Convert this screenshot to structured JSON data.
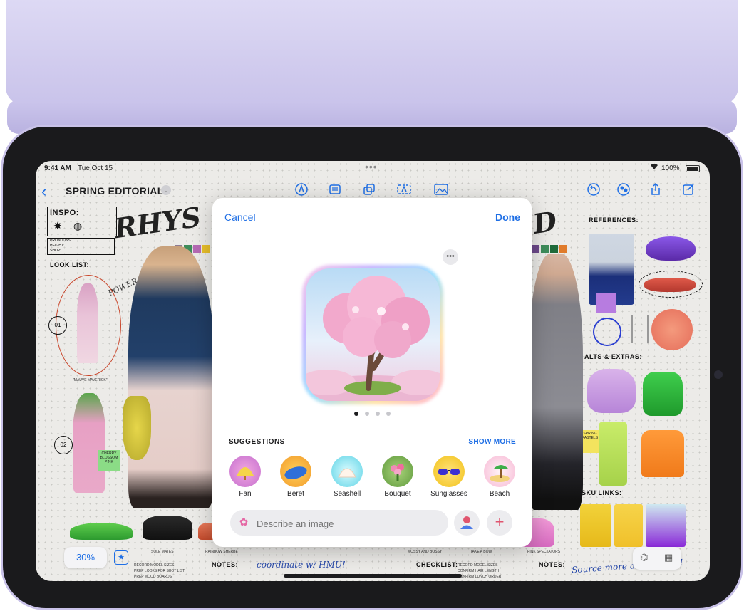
{
  "status_bar": {
    "time": "9:41 AM",
    "date": "Tue Oct 15",
    "battery": "100%"
  },
  "toolbar": {
    "title": "SPRING EDITORIAL"
  },
  "board": {
    "inspo": "INSPO:",
    "pronouns": "PRONOUNS:",
    "height": "HEIGHT:",
    "shop": "SHOP:",
    "look_list": "LOOK LIST:",
    "rhys": "RHYS",
    "power_in_pink": "POWER IN PINK",
    "look_01": "01",
    "look_02": "02",
    "mauve_maverick": "\"MAUVE MAVERICK\"",
    "cherry_blossom_pink": "CHERRY BLOSSOM PINK",
    "references": "REFERENCES:",
    "alts_extras": "ALTS & EXTRAS:",
    "spring_pastels": "SPRING PASTELS",
    "sku_links": "SKU LINKS:",
    "notes_left": "NOTES:",
    "checklist": "CHECKLIST:",
    "notes_right": "NOTES:",
    "handwritten_left": "coordinate w/ HMU!",
    "handwritten_right": "Source more accessories!",
    "sole_mates": "SOLE MATES",
    "rainbow_sherbet": "RAINBOW SHERBET",
    "mossy_and_bossy": "MOSSY AND BOSSY",
    "take_a_bow": "TAKE A BOW",
    "pink_spectators": "PINK SPECTATORS",
    "record_model_sizes": "RECORD MODEL SIZES",
    "prep_looks": "PREP LOOKS FOR SHOT LIST",
    "prep_mood": "PREP MOOD BOARDS",
    "confirm_hair": "CONFIRM HAIR LENGTH",
    "confirm_lunch": "CONFIRM LUNCH ORDER"
  },
  "zoom": "30%",
  "modal": {
    "cancel": "Cancel",
    "done": "Done",
    "suggestions_title": "SUGGESTIONS",
    "show_more": "SHOW MORE",
    "suggestions": [
      {
        "label": "Fan"
      },
      {
        "label": "Beret"
      },
      {
        "label": "Seashell"
      },
      {
        "label": "Bouquet"
      },
      {
        "label": "Sunglasses"
      },
      {
        "label": "Beach"
      }
    ],
    "prompt_placeholder": "Describe an image",
    "page_count": 4,
    "current_page": 1
  },
  "colors": {
    "accent": "#1f6fe5",
    "cover": "#cbc5ec"
  }
}
